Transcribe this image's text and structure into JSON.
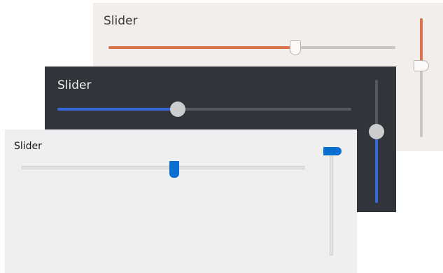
{
  "window_title": "Slider",
  "panels": [
    {
      "theme": "orange",
      "title": "Slider",
      "accent": "#d9744a",
      "track": "#c9c7c4",
      "h_slider": {
        "value": 0.65
      },
      "v_slider": {
        "value": 0.6
      }
    },
    {
      "theme": "dark",
      "title": "Slider",
      "accent": "#3567d8",
      "track": "#57585f",
      "h_slider": {
        "value": 0.41
      },
      "v_slider": {
        "value": 0.58
      }
    },
    {
      "theme": "blue",
      "title": "Slider",
      "accent": "#0a6fd0",
      "track": "#e1e1e1",
      "h_slider": {
        "value": 0.54
      },
      "v_slider": {
        "value": 1.0
      }
    }
  ]
}
